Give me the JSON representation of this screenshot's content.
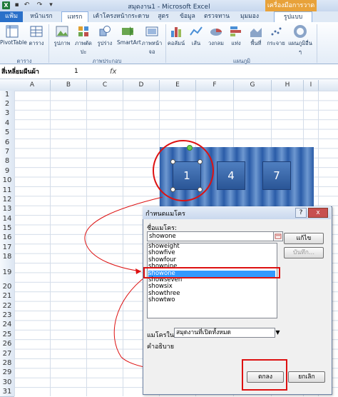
{
  "window": {
    "title": "สมุดงาน1  -  Microsoft Excel",
    "context_tab": "เครื่องมือการวาด"
  },
  "tabs": {
    "file": "แฟ้ม",
    "items": [
      "หน้าแรก",
      "แทรก",
      "เค้าโครงหน้ากระดาษ",
      "สูตร",
      "ข้อมูล",
      "ตรวจทาน",
      "มุมมอง",
      "รูปแบบ"
    ],
    "active": "แทรก"
  },
  "ribbon": {
    "buttons": [
      "PivotTable",
      "ตาราง",
      "รูปภาพ",
      "ภาพตัดปะ",
      "รูปร่าง",
      "SmartArt",
      "ภาพหน้าจอ",
      "คอลัมน์",
      "เส้น",
      "วงกลม",
      "แท่ง",
      "พื้นที่",
      "กระจาย",
      "แผนภูมิอื่น ๆ"
    ],
    "groups": [
      "ตาราง",
      "ภาพประกอบ",
      "แผนภูมิ"
    ]
  },
  "formula_bar": {
    "name_box": "สี่เหลี่ยมผืนผ้า",
    "value": "1",
    "fx": "fx"
  },
  "sheet": {
    "columns": [
      "A",
      "B",
      "C",
      "D",
      "E",
      "F",
      "G",
      "H",
      "I"
    ],
    "rows": [
      "1",
      "2",
      "3",
      "4",
      "5",
      "6",
      "7",
      "8",
      "9",
      "10",
      "11",
      "12",
      "13",
      "14",
      "15",
      "16",
      "17",
      "18",
      "19",
      "20",
      "21",
      "22",
      "23",
      "24",
      "25",
      "26",
      "27",
      "28",
      "29",
      "30",
      "31"
    ]
  },
  "picture": {
    "tiles": [
      "1",
      "4",
      "7"
    ]
  },
  "dialog": {
    "title": "กำหนดแมโคร",
    "help": "?",
    "close": "x",
    "macro_name_label": "ชื่อแมโคร:",
    "macro_name_value": "showone",
    "macro_list": [
      "showeight",
      "showfive",
      "showfour",
      "shownine",
      "showone",
      "showseven",
      "showsix",
      "showthree",
      "showtwo"
    ],
    "selected": "showone",
    "buttons": {
      "edit": "แก้ไข",
      "record": "บันทึก...",
      "ok": "ตกลง",
      "cancel": "ยกเลิก"
    },
    "macros_in_label": "แมโครใน:",
    "macros_in_value": "สมุดงานที่เปิดทั้งหมด",
    "description_label": "คำอธิบาย"
  }
}
